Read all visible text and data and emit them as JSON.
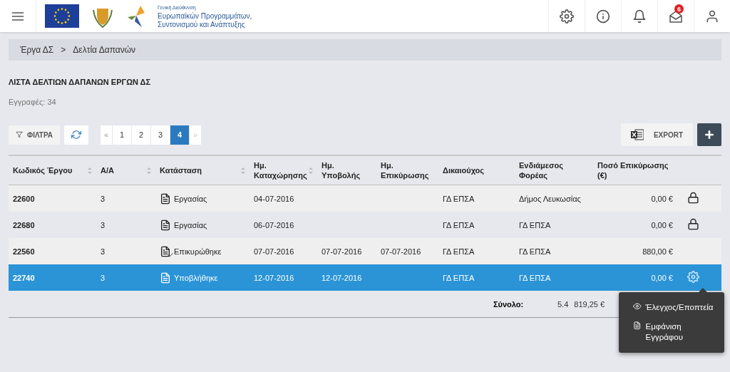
{
  "header": {
    "logo_text": [
      "Γενική Διεύθυνση",
      "Ευρωπαϊκών Προγραμμάτων,",
      "Συντονισμού και Ανάπτυξης"
    ],
    "mail_badge": "6"
  },
  "breadcrumb": [
    "Έργα ΔΣ",
    "Δελτία Δαπανών"
  ],
  "breadcrumb_separator": ">",
  "title": "ΛΙΣΤΑ ΔΕΛΤΙΩΝ ΔΑΠΑΝΩΝ ΕΡΓΩΝ ΔΣ",
  "record_count": "Εγγραφές: 34",
  "filters_button": "ΦΙΛΤΡΑ",
  "pagination": {
    "prev": "«",
    "next": "»",
    "pages": [
      {
        "label": "1",
        "selected": false
      },
      {
        "label": "2",
        "selected": false
      },
      {
        "label": "3",
        "selected": false
      },
      {
        "label": "4",
        "selected": true
      }
    ]
  },
  "export_button": "EXPORT",
  "table": {
    "columns": [
      {
        "label": "Κωδικός Έργου",
        "sortable": true
      },
      {
        "label": "Α/Α",
        "sortable": true
      },
      {
        "label": "Κατάσταση",
        "sortable": true
      },
      {
        "label": "Ημ. Καταχώρησης",
        "sortable": true
      },
      {
        "label": "Ημ. Υποβολής",
        "sortable": false
      },
      {
        "label": "Ημ. Επικύρωσης",
        "sortable": false
      },
      {
        "label": "Δικαιούχος",
        "sortable": false
      },
      {
        "label": "Ενδιάμεσος Φορέας",
        "sortable": false
      },
      {
        "label": "Ποσό Επικύρωσης (€)",
        "sortable": false
      }
    ],
    "rows": [
      {
        "code": "22600",
        "aa": "3",
        "status": "Εργασίας",
        "kind": "draft",
        "registered": "04-07-2016",
        "submitted": "",
        "validated": "",
        "beneficiary": "ΓΔ ΕΠΣΑ",
        "intermediate": "Δήμος Λευκωσίας",
        "amount": "0,00 €",
        "locked": true,
        "selected": false
      },
      {
        "code": "22680",
        "aa": "3",
        "status": "Εργασίας",
        "kind": "draft",
        "registered": "06-07-2016",
        "submitted": "",
        "validated": "",
        "beneficiary": "ΓΔ ΕΠΣΑ",
        "intermediate": "ΓΔ ΕΠΣΑ",
        "amount": "0,00 €",
        "locked": true,
        "selected": false
      },
      {
        "code": "22560",
        "aa": "3",
        "status": "Επικυρώθηκε",
        "kind": "validated",
        "registered": "07-07-2016",
        "submitted": "07-07-2016",
        "validated": "07-07-2016",
        "beneficiary": "ΓΔ ΕΠΣΑ",
        "intermediate": "ΓΔ ΕΠΣΑ",
        "amount": "880,00 €",
        "locked": false,
        "selected": false
      },
      {
        "code": "22740",
        "aa": "3",
        "status": "Υποβλήθηκε",
        "kind": "submitted",
        "registered": "12-07-2016",
        "submitted": "12-07-2016",
        "validated": "",
        "beneficiary": "ΓΔ ΕΠΣΑ",
        "intermediate": "ΓΔ ΕΠΣΑ",
        "amount": "0,00 €",
        "locked": false,
        "selected": true
      }
    ],
    "total_label": "Σύνολο:",
    "total_value_parts": [
      "5.4",
      "819,25 €"
    ]
  },
  "context_menu": [
    {
      "label": "Έλεγχος/Εποπτεία",
      "kind": "view"
    },
    {
      "label": "Εμφάνιση Εγγράφου",
      "kind": "document"
    }
  ]
}
